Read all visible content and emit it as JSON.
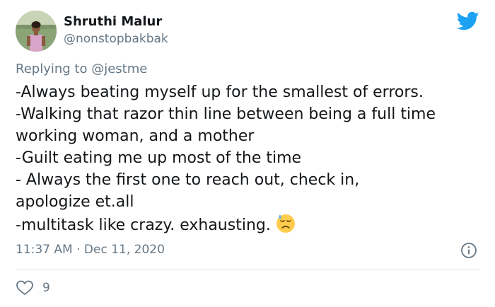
{
  "author": {
    "name": "Shruthi Malur",
    "handle": "@nonstopbakbak"
  },
  "icons": {
    "brand": "twitter-bird-icon",
    "info": "info-icon",
    "like": "heart-icon",
    "emoji": "downcast-face-with-sweat-emoji"
  },
  "reply": {
    "prefix": "Replying to",
    "mention": "@jestme"
  },
  "body_lines": [
    "-Always beating myself up for the smallest of errors.",
    "-Walking that razor thin line between being a full time",
    "working woman, and a mother",
    "-Guilt eating me up most of the time",
    "- Always the first one to reach out, check in,",
    "apologize et.all",
    "-multitask like crazy. exhausting."
  ],
  "timestamp": {
    "time": "11:37 AM",
    "separator": "·",
    "date": "Dec 11, 2020"
  },
  "likes": {
    "count": "9"
  },
  "colors": {
    "brand": "#1da1f2",
    "text": "#14171a",
    "secondary": "#657786",
    "divider": "#e1e8ed"
  }
}
